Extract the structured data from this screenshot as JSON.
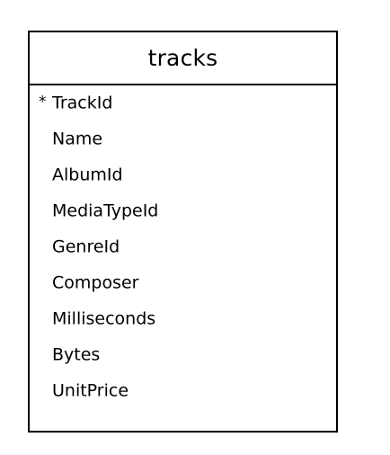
{
  "entity": {
    "title": "tracks",
    "fields": [
      {
        "marker": "*",
        "name": "TrackId"
      },
      {
        "marker": "",
        "name": "Name"
      },
      {
        "marker": "",
        "name": "AlbumId"
      },
      {
        "marker": "",
        "name": "MediaTypeId"
      },
      {
        "marker": "",
        "name": "GenreId"
      },
      {
        "marker": "",
        "name": "Composer"
      },
      {
        "marker": "",
        "name": "Milliseconds"
      },
      {
        "marker": "",
        "name": "Bytes"
      },
      {
        "marker": "",
        "name": "UnitPrice"
      }
    ]
  }
}
